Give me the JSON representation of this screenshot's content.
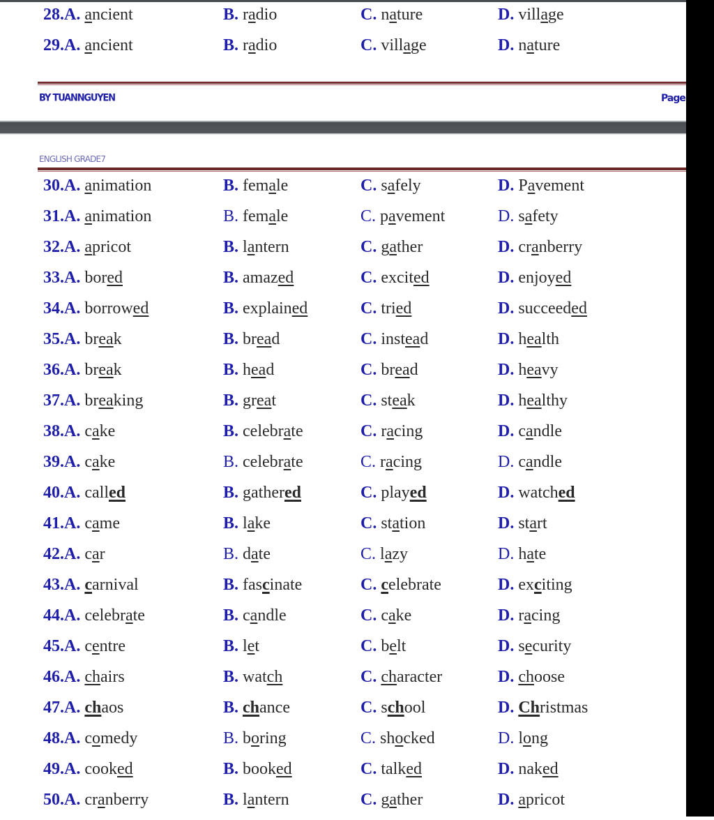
{
  "document": {
    "footer": {
      "author": "BY TUANNGUYEN",
      "page_label": "Page"
    },
    "header": {
      "title": "ENGLISH GRADE7"
    }
  },
  "questions": [
    {
      "number": "28",
      "options": [
        {
          "label": "A.",
          "pre": "",
          "mark": "a",
          "post": "ncient"
        },
        {
          "label": "B.",
          "pre": "r",
          "mark": "a",
          "post": "dio"
        },
        {
          "label": "C.",
          "pre": "n",
          "mark": "a",
          "post": "ture"
        },
        {
          "label": "D.",
          "pre": "vill",
          "mark": "a",
          "post": "ge"
        }
      ]
    },
    {
      "number": "29",
      "options": [
        {
          "label": "A.",
          "pre": "",
          "mark": "a",
          "post": "ncient"
        },
        {
          "label": "B.",
          "pre": "r",
          "mark": "a",
          "post": "dio"
        },
        {
          "label": "C.",
          "pre": "vill",
          "mark": "a",
          "post": "ge"
        },
        {
          "label": "D.",
          "pre": "n",
          "mark": "a",
          "post": "ture"
        }
      ]
    },
    {
      "number": "30",
      "options": [
        {
          "label": "A.",
          "pre": "",
          "mark": "a",
          "post": "nimation"
        },
        {
          "label": "B.",
          "pre": "fem",
          "mark": "a",
          "post": "le"
        },
        {
          "label": "C.",
          "pre": "s",
          "mark": "a",
          "post": "fely"
        },
        {
          "label": "D.",
          "pre": "P",
          "mark": "a",
          "post": "vement"
        }
      ]
    },
    {
      "number": "31",
      "options": [
        {
          "label": "A.",
          "pre": "",
          "mark": "a",
          "post": "nimation"
        },
        {
          "label": "B.",
          "pre": "fem",
          "mark": "a",
          "post": "le"
        },
        {
          "label": "C.",
          "pre": "p",
          "mark": "a",
          "post": "vement"
        },
        {
          "label": "D.",
          "pre": "s",
          "mark": "a",
          "post": "fety"
        }
      ]
    },
    {
      "number": "32",
      "options": [
        {
          "label": "A.",
          "pre": "",
          "mark": "a",
          "post": "pricot"
        },
        {
          "label": "B.",
          "pre": "l",
          "mark": "a",
          "post": "ntern"
        },
        {
          "label": "C.",
          "pre": "g",
          "mark": "a",
          "post": "ther"
        },
        {
          "label": "D.",
          "pre": "cr",
          "mark": "a",
          "post": "nberry"
        }
      ]
    },
    {
      "number": "33",
      "options": [
        {
          "label": "A.",
          "pre": "bor",
          "mark": "ed",
          "post": ""
        },
        {
          "label": "B.",
          "pre": "amaz",
          "mark": "ed",
          "post": ""
        },
        {
          "label": "C.",
          "pre": "excit",
          "mark": "ed",
          "post": ""
        },
        {
          "label": "D.",
          "pre": "enjoy",
          "mark": "ed",
          "post": ""
        }
      ]
    },
    {
      "number": "34",
      "options": [
        {
          "label": "A.",
          "pre": "borrow",
          "mark": "ed",
          "post": ""
        },
        {
          "label": "B.",
          "pre": "explain",
          "mark": "ed",
          "post": ""
        },
        {
          "label": "C.",
          "pre": "tri",
          "mark": "ed",
          "post": ""
        },
        {
          "label": "D.",
          "pre": "succeed",
          "mark": "ed",
          "post": ""
        }
      ]
    },
    {
      "number": "35",
      "options": [
        {
          "label": "A.",
          "pre": "br",
          "mark": "ea",
          "post": "k"
        },
        {
          "label": "B.",
          "pre": "br",
          "mark": "ea",
          "post": "d"
        },
        {
          "label": "C.",
          "pre": "inst",
          "mark": "ea",
          "post": "d"
        },
        {
          "label": "D.",
          "pre": "h",
          "mark": "ea",
          "post": "lth"
        }
      ]
    },
    {
      "number": "36",
      "options": [
        {
          "label": "A.",
          "pre": "br",
          "mark": "ea",
          "post": "k"
        },
        {
          "label": "B.",
          "pre": "h",
          "mark": "ea",
          "post": "d"
        },
        {
          "label": "C.",
          "pre": "br",
          "mark": "ea",
          "post": "d"
        },
        {
          "label": "D.",
          "pre": "h",
          "mark": "ea",
          "post": "vy"
        }
      ]
    },
    {
      "number": "37",
      "options": [
        {
          "label": "A.",
          "pre": "br",
          "mark": "ea",
          "post": "king"
        },
        {
          "label": "B.",
          "pre": "gr",
          "mark": "ea",
          "post": "t"
        },
        {
          "label": "C.",
          "pre": "st",
          "mark": "ea",
          "post": "k"
        },
        {
          "label": "D.",
          "pre": "h",
          "mark": "ea",
          "post": "lthy"
        }
      ]
    },
    {
      "number": "38",
      "options": [
        {
          "label": "A.",
          "pre": "c",
          "mark": "a",
          "post": "ke"
        },
        {
          "label": "B.",
          "pre": "celebr",
          "mark": "a",
          "post": "te"
        },
        {
          "label": "C.",
          "pre": "r",
          "mark": "a",
          "post": "cing"
        },
        {
          "label": "D.",
          "pre": "c",
          "mark": "a",
          "post": "ndle"
        }
      ]
    },
    {
      "number": "39",
      "options": [
        {
          "label": "A.",
          "pre": "c",
          "mark": "a",
          "post": "ke"
        },
        {
          "label": "B.",
          "pre": "celebr",
          "mark": "a",
          "post": "te"
        },
        {
          "label": "C.",
          "pre": "r",
          "mark": "a",
          "post": "cing"
        },
        {
          "label": "D.",
          "pre": "c",
          "mark": "a",
          "post": "ndle"
        }
      ]
    },
    {
      "number": "40",
      "options": [
        {
          "label": "A.",
          "pre": "call",
          "mark": "ed",
          "post": "",
          "bold": true
        },
        {
          "label": "B.",
          "pre": "gather",
          "mark": "ed",
          "post": "",
          "bold": true
        },
        {
          "label": "C.",
          "pre": "play",
          "mark": "ed",
          "post": "",
          "bold": true
        },
        {
          "label": "D.",
          "pre": "watch",
          "mark": "ed",
          "post": "",
          "bold": true
        }
      ]
    },
    {
      "number": "41",
      "options": [
        {
          "label": "A.",
          "pre": "c",
          "mark": "a",
          "post": "me"
        },
        {
          "label": "B.",
          "pre": "l",
          "mark": "a",
          "post": "ke"
        },
        {
          "label": "C.",
          "pre": "st",
          "mark": "a",
          "post": "tion"
        },
        {
          "label": "D.",
          "pre": "st",
          "mark": "a",
          "post": "rt"
        }
      ]
    },
    {
      "number": "42",
      "options": [
        {
          "label": "A.",
          "pre": "c",
          "mark": "a",
          "post": "r"
        },
        {
          "label": "B.",
          "pre": "d",
          "mark": "a",
          "post": "te"
        },
        {
          "label": "C.",
          "pre": "l",
          "mark": "a",
          "post": "zy"
        },
        {
          "label": "D.",
          "pre": "h",
          "mark": "a",
          "post": "te"
        }
      ]
    },
    {
      "number": "43",
      "options": [
        {
          "label": "A.",
          "pre": "",
          "mark": "c",
          "post": "arnival",
          "bold": true
        },
        {
          "label": "B.",
          "pre": "fas",
          "mark": "c",
          "post": "inate",
          "bold": true
        },
        {
          "label": "C.",
          "pre": "",
          "mark": "c",
          "post": "elebrate",
          "bold": true
        },
        {
          "label": "D.",
          "pre": "ex",
          "mark": "c",
          "post": "iting",
          "bold": true
        }
      ]
    },
    {
      "number": "44",
      "options": [
        {
          "label": "A.",
          "pre": "celebr",
          "mark": "a",
          "post": "te"
        },
        {
          "label": "B.",
          "pre": "c",
          "mark": "a",
          "post": "ndle"
        },
        {
          "label": "C.",
          "pre": "c",
          "mark": "a",
          "post": "ke"
        },
        {
          "label": "D.",
          "pre": "r",
          "mark": "a",
          "post": "cing"
        }
      ]
    },
    {
      "number": "45",
      "options": [
        {
          "label": "A.",
          "pre": "c",
          "mark": "e",
          "post": "ntre"
        },
        {
          "label": "B.",
          "pre": "l",
          "mark": "e",
          "post": "t"
        },
        {
          "label": "C.",
          "pre": "b",
          "mark": "e",
          "post": "lt"
        },
        {
          "label": "D.",
          "pre": "s",
          "mark": "e",
          "post": "curity"
        }
      ]
    },
    {
      "number": "46",
      "options": [
        {
          "label": "A.",
          "pre": "",
          "mark": "ch",
          "post": "airs"
        },
        {
          "label": "B.",
          "pre": "wat",
          "mark": "ch",
          "post": ""
        },
        {
          "label": "C.",
          "pre": "",
          "mark": "ch",
          "post": "aracter"
        },
        {
          "label": "D.",
          "pre": "",
          "mark": "ch",
          "post": "oose"
        }
      ]
    },
    {
      "number": "47",
      "options": [
        {
          "label": "A.",
          "pre": "",
          "mark": "ch",
          "post": "aos",
          "bold": true
        },
        {
          "label": "B.",
          "pre": "",
          "mark": "ch",
          "post": "ance",
          "bold": true
        },
        {
          "label": "C.",
          "pre": "s",
          "mark": "ch",
          "post": "ool",
          "bold": true
        },
        {
          "label": "D.",
          "pre": "",
          "mark": "Ch",
          "post": "ristmas",
          "bold": true
        }
      ]
    },
    {
      "number": "48",
      "options": [
        {
          "label": "A.",
          "pre": "c",
          "mark": "o",
          "post": "medy"
        },
        {
          "label": "B.",
          "pre": "b",
          "mark": "o",
          "post": "ring"
        },
        {
          "label": "C.",
          "pre": "sh",
          "mark": "o",
          "post": "cked"
        },
        {
          "label": "D.",
          "pre": "l",
          "mark": "o",
          "post": "ng"
        }
      ]
    },
    {
      "number": "49",
      "options": [
        {
          "label": "A.",
          "pre": "cook",
          "mark": "ed",
          "post": ""
        },
        {
          "label": "B.",
          "pre": "book",
          "mark": "ed ",
          "post": ""
        },
        {
          "label": "C.",
          "pre": "talk",
          "mark": "ed",
          "post": ""
        },
        {
          "label": "D.",
          "pre": "nak",
          "mark": "ed",
          "post": ""
        }
      ]
    },
    {
      "number": "50",
      "options": [
        {
          "label": "A.",
          "pre": "cr",
          "mark": "a",
          "post": "nberry"
        },
        {
          "label": "B.",
          "pre": "l",
          "mark": "a",
          "post": "ntern"
        },
        {
          "label": "C.",
          "pre": "g",
          "mark": "a",
          "post": "ther"
        },
        {
          "label": "D.",
          "pre": "",
          "mark": "a",
          "post": "pricot"
        }
      ]
    }
  ]
}
